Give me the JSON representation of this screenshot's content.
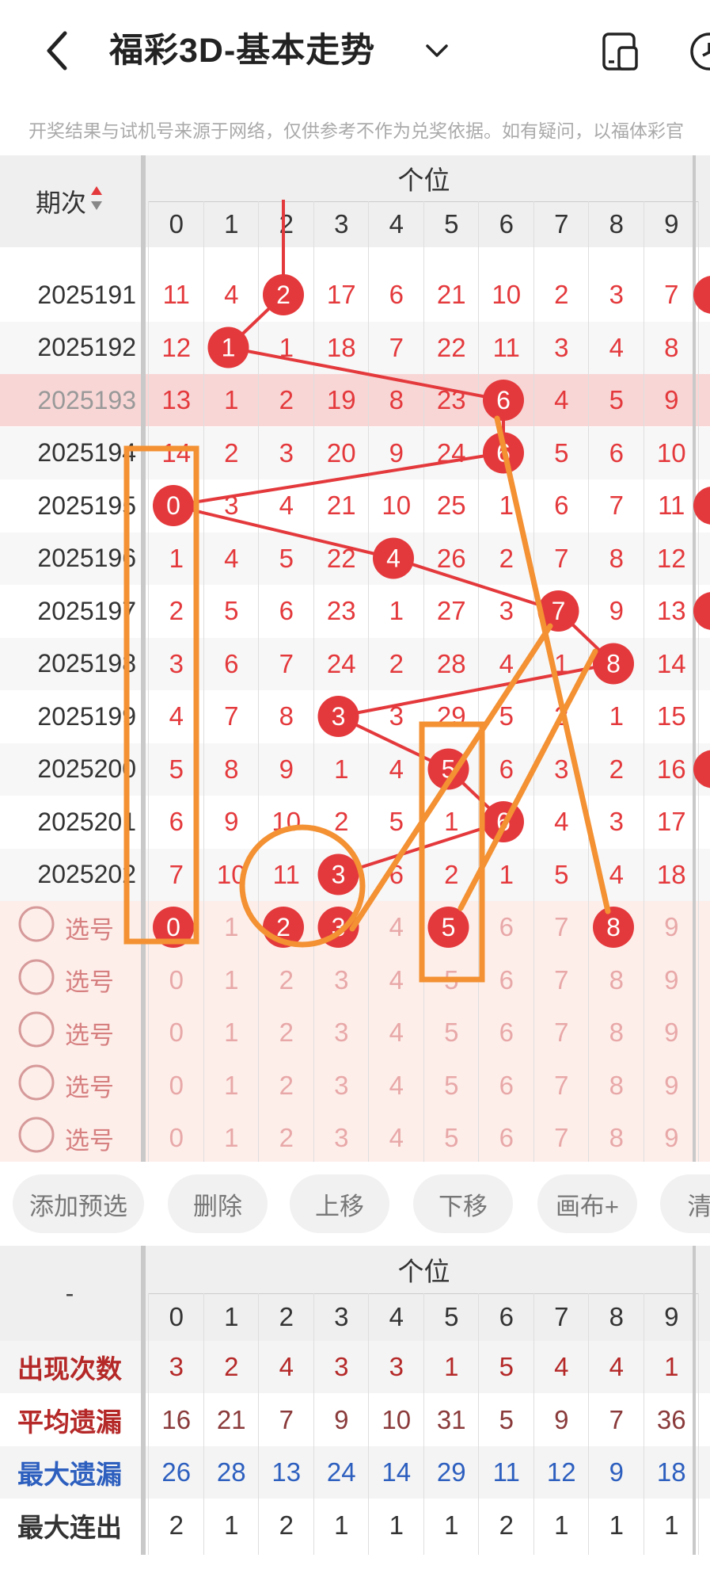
{
  "header": {
    "title": "福彩3D-基本走势",
    "notice": "开奖结果与试机号来源于网络，仅供参考不作为兑奖依据。如有疑问，以福体彩官"
  },
  "trend": {
    "period_header": "期次",
    "group_header": "个位",
    "columns": [
      "0",
      "1",
      "2",
      "3",
      "4",
      "5",
      "6",
      "7",
      "8",
      "9"
    ],
    "rows": [
      {
        "period": "2025191",
        "values": [
          "11",
          "4",
          "2",
          "17",
          "6",
          "21",
          "10",
          "2",
          "3",
          "7"
        ],
        "hit": 2,
        "highlight": false
      },
      {
        "period": "2025192",
        "values": [
          "12",
          "1",
          "1",
          "18",
          "7",
          "22",
          "11",
          "3",
          "4",
          "8"
        ],
        "hit": 1,
        "highlight": false
      },
      {
        "period": "2025193",
        "values": [
          "13",
          "1",
          "2",
          "19",
          "8",
          "23",
          "6",
          "4",
          "5",
          "9"
        ],
        "hit": 6,
        "highlight": true
      },
      {
        "period": "2025194",
        "values": [
          "14",
          "2",
          "3",
          "20",
          "9",
          "24",
          "6",
          "5",
          "6",
          "10"
        ],
        "hit": 6,
        "highlight": false
      },
      {
        "period": "2025195",
        "values": [
          "0",
          "3",
          "4",
          "21",
          "10",
          "25",
          "1",
          "6",
          "7",
          "11"
        ],
        "hit": 0,
        "highlight": false
      },
      {
        "period": "2025196",
        "values": [
          "1",
          "4",
          "5",
          "22",
          "4",
          "26",
          "2",
          "7",
          "8",
          "12"
        ],
        "hit": 4,
        "highlight": false
      },
      {
        "period": "2025197",
        "values": [
          "2",
          "5",
          "6",
          "23",
          "1",
          "27",
          "3",
          "7",
          "9",
          "13"
        ],
        "hit": 7,
        "highlight": false
      },
      {
        "period": "2025198",
        "values": [
          "3",
          "6",
          "7",
          "24",
          "2",
          "28",
          "4",
          "1",
          "8",
          "14"
        ],
        "hit": 8,
        "highlight": false
      },
      {
        "period": "2025199",
        "values": [
          "4",
          "7",
          "8",
          "3",
          "3",
          "29",
          "5",
          "2",
          "1",
          "15"
        ],
        "hit": 3,
        "highlight": false
      },
      {
        "period": "2025200",
        "values": [
          "5",
          "8",
          "9",
          "1",
          "4",
          "5",
          "6",
          "3",
          "2",
          "16"
        ],
        "hit": 5,
        "highlight": false
      },
      {
        "period": "2025201",
        "values": [
          "6",
          "9",
          "10",
          "2",
          "5",
          "1",
          "6",
          "4",
          "3",
          "17"
        ],
        "hit": 6,
        "highlight": false
      },
      {
        "period": "2025202",
        "values": [
          "7",
          "10",
          "11",
          "3",
          "6",
          "2",
          "1",
          "5",
          "4",
          "18"
        ],
        "hit": 3,
        "highlight": false
      }
    ],
    "pick_label": "选号",
    "pick_rows": [
      {
        "values": [
          "0",
          "1",
          "2",
          "3",
          "4",
          "5",
          "6",
          "7",
          "8",
          "9"
        ],
        "selected": [
          0,
          2,
          3,
          5,
          8
        ]
      },
      {
        "values": [
          "0",
          "1",
          "2",
          "3",
          "4",
          "5",
          "6",
          "7",
          "8",
          "9"
        ],
        "selected": []
      },
      {
        "values": [
          "0",
          "1",
          "2",
          "3",
          "4",
          "5",
          "6",
          "7",
          "8",
          "9"
        ],
        "selected": []
      },
      {
        "values": [
          "0",
          "1",
          "2",
          "3",
          "4",
          "5",
          "6",
          "7",
          "8",
          "9"
        ],
        "selected": []
      },
      {
        "values": [
          "0",
          "1",
          "2",
          "3",
          "4",
          "5",
          "6",
          "7",
          "8",
          "9"
        ],
        "selected": []
      }
    ]
  },
  "toolbar": {
    "buttons": [
      "添加预选",
      "删除",
      "上移",
      "下移",
      "画布+",
      "清"
    ]
  },
  "stats": {
    "corner": "-",
    "group_header": "个位",
    "columns": [
      "0",
      "1",
      "2",
      "3",
      "4",
      "5",
      "6",
      "7",
      "8",
      "9"
    ],
    "rows": [
      {
        "label": "出现次数",
        "values": [
          "3",
          "2",
          "4",
          "3",
          "3",
          "1",
          "5",
          "4",
          "4",
          "1"
        ],
        "label_color": "#b52828",
        "value_color": "#b52828"
      },
      {
        "label": "平均遗漏",
        "values": [
          "16",
          "21",
          "7",
          "9",
          "10",
          "31",
          "5",
          "9",
          "7",
          "36"
        ],
        "label_color": "#b52828",
        "value_color": "#8a3a3a"
      },
      {
        "label": "最大遗漏",
        "values": [
          "26",
          "28",
          "13",
          "24",
          "14",
          "29",
          "11",
          "12",
          "9",
          "18"
        ],
        "label_color": "#2d5fbf",
        "value_color": "#2d5fbf"
      },
      {
        "label": "最大连出",
        "values": [
          "2",
          "1",
          "2",
          "1",
          "1",
          "1",
          "2",
          "1",
          "1",
          "1"
        ],
        "label_color": "#333333",
        "value_color": "#333333"
      }
    ]
  },
  "colors": {
    "red": "#e4393c",
    "orange": "#f39133",
    "highlight_row": "#f8d6d6",
    "pick_bg": "#fdeeea"
  }
}
